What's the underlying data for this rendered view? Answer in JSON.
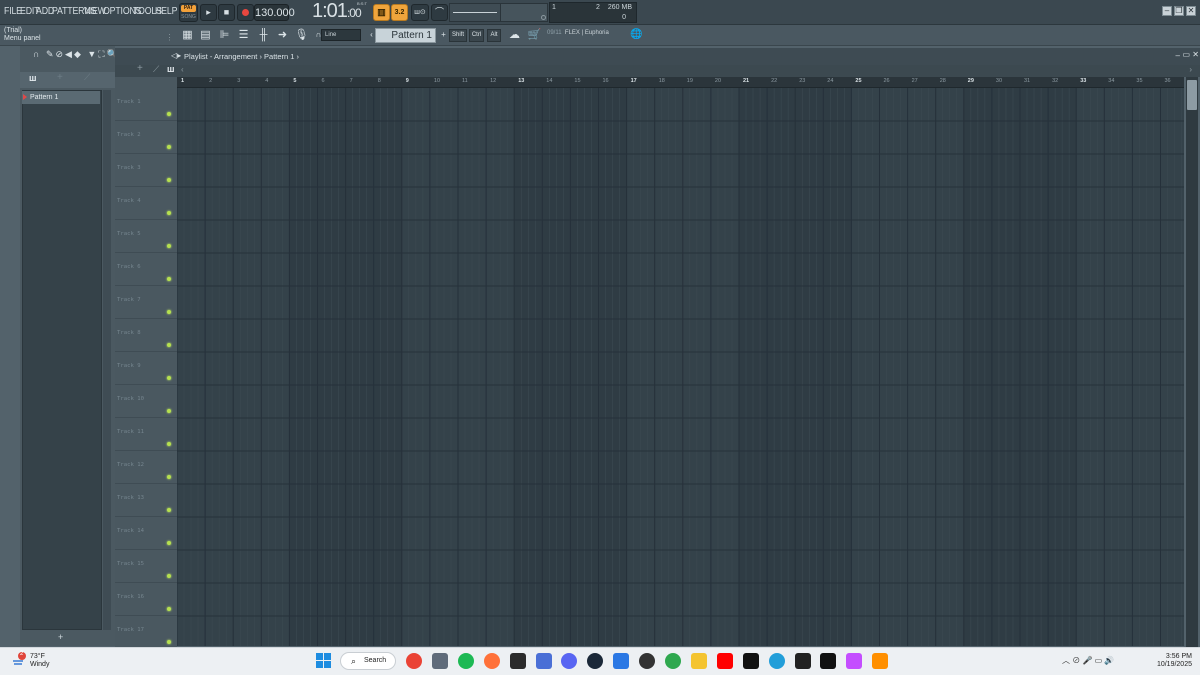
{
  "menu": {
    "items": [
      "FILE",
      "EDIT",
      "ADD",
      "PATTERNS",
      "VIEW",
      "OPTIONS",
      "TOOLS",
      "HELP"
    ]
  },
  "transport": {
    "mode_pattern": "PAT",
    "mode_song": "SONG",
    "tempo": "130.000",
    "time_main": "1:01",
    "time_sub": ":00",
    "time_format": "B:S:T",
    "metronome_label": "3.2",
    "cpu_voices": "1",
    "polyphony": "2",
    "memory": "260 MB",
    "memory_sub": "0"
  },
  "hint_bar": {
    "line1": "(Trial)",
    "line2": "Menu panel"
  },
  "toolbar": {
    "snap_value": "Line",
    "pattern_selector": "Pattern 1",
    "shift_label": "Shift",
    "ctrl_label": "Ctrl",
    "alt_label": "Alt",
    "news_counter": "09/11",
    "news_text": "FLEX | Euphoria"
  },
  "browser": {
    "items": [
      {
        "label": "Pattern 1"
      }
    ],
    "add_label": "+"
  },
  "playlist": {
    "title": "Playlist - Arrangement › Pattern 1 ›",
    "tracks": [
      "Track 1",
      "Track 2",
      "Track 3",
      "Track 4",
      "Track 5",
      "Track 6",
      "Track 7",
      "Track 8",
      "Track 9",
      "Track 10",
      "Track 11",
      "Track 12",
      "Track 13",
      "Track 14",
      "Track 15",
      "Track 16",
      "Track 17"
    ],
    "bars": [
      "1",
      "2",
      "3",
      "4",
      "5",
      "6",
      "7",
      "8",
      "9",
      "10",
      "11",
      "12",
      "13",
      "14",
      "15",
      "16",
      "17",
      "18",
      "19",
      "20",
      "21",
      "22",
      "23",
      "24",
      "25",
      "26",
      "27",
      "28",
      "29",
      "30",
      "31",
      "32",
      "33",
      "34",
      "35",
      "36"
    ]
  },
  "taskbar": {
    "weather_temp": "73°F",
    "weather_desc": "Windy",
    "weather_badge": "2",
    "search_label": "Search",
    "time": "3:56 PM",
    "date": "10/19/2025",
    "icons": [
      "windows-start-icon",
      "chrome-icon",
      "settings-icon",
      "spotify-icon",
      "firefox-icon",
      "epic-games-icon",
      "notepad-icon",
      "discord-icon",
      "steam-icon",
      "store-icon",
      "clock-app-icon",
      "vpn-icon",
      "file-explorer-icon",
      "youtube-icon",
      "tradingview-icon",
      "telegram-icon",
      "terminal-icon",
      "capcut-icon",
      "copilot-icon",
      "fl-studio-icon"
    ]
  },
  "colors": {
    "accent_orange": "#f0a53c",
    "track_led": "#b6e04f",
    "grid_bg": "#34424a",
    "panel_bg": "#4b5961"
  }
}
